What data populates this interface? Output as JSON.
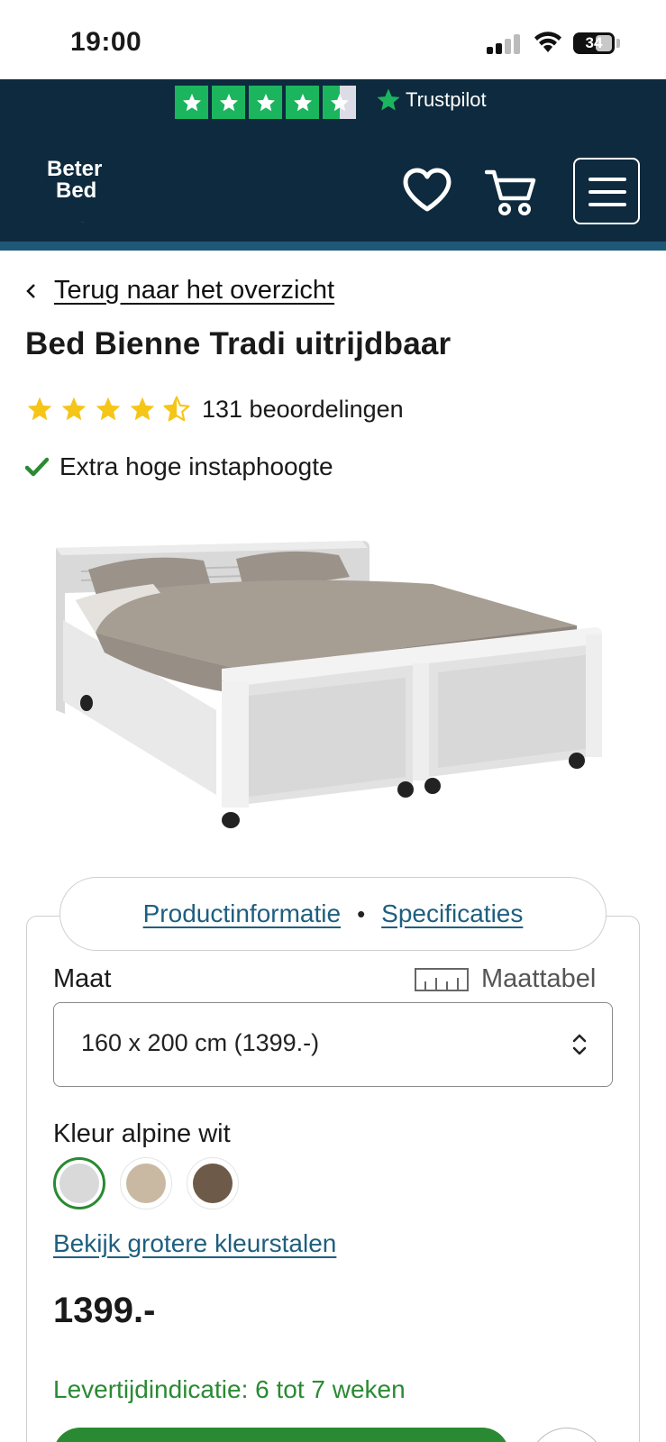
{
  "status_bar": {
    "time": "19:00",
    "battery": "34"
  },
  "trustpilot": {
    "label": "Trustpilot",
    "stars": 4.5
  },
  "header": {
    "logo_line1": "Beter",
    "logo_line2": "Bed",
    "icons": [
      "heart-icon",
      "cart-icon",
      "menu-icon"
    ]
  },
  "nav": {
    "back_label": "Terug naar het overzicht"
  },
  "product": {
    "title": "Bed Bienne Tradi uitrijdbaar",
    "rating": 4.5,
    "reviews_label": "131 beoordelingen",
    "usp": "Extra hoge instaphoogte"
  },
  "tabs": {
    "info": "Productinformatie",
    "specs": "Specificaties",
    "separator": "•"
  },
  "config": {
    "size_label": "Maat",
    "size_table": "Maattabel",
    "size_value": "160 x 200 cm (1399.-)",
    "color_label": "Kleur alpine wit",
    "colors": [
      "#d9d9d9",
      "#c9b9a2",
      "#6e5a48"
    ],
    "larger_swatches": "Bekijk grotere kleurstalen",
    "price": "1399.-",
    "delivery": "Levertijdindicatie: 6 tot 7 weken"
  },
  "colors": {
    "navy": "#0e2a3e",
    "green": "#2a8a33",
    "link": "#1e5f7f",
    "star": "#f5c518",
    "trust_green": "#1bb55e"
  }
}
